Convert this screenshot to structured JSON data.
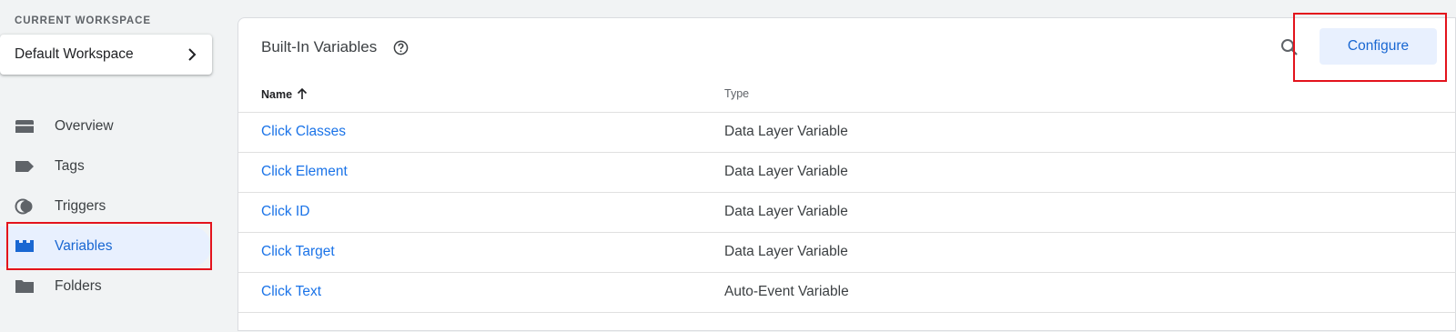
{
  "sidebar": {
    "workspace_label": "CURRENT WORKSPACE",
    "workspace_name": "Default Workspace",
    "items": [
      {
        "label": "Overview",
        "icon": "overview-icon"
      },
      {
        "label": "Tags",
        "icon": "tag-icon"
      },
      {
        "label": "Triggers",
        "icon": "trigger-icon"
      },
      {
        "label": "Variables",
        "icon": "variables-icon",
        "active": true
      },
      {
        "label": "Folders",
        "icon": "folder-icon"
      }
    ]
  },
  "main": {
    "title": "Built-In Variables",
    "configure_label": "Configure",
    "columns": {
      "name": "Name",
      "type": "Type"
    },
    "rows": [
      {
        "name": "Click Classes",
        "type": "Data Layer Variable"
      },
      {
        "name": "Click Element",
        "type": "Data Layer Variable"
      },
      {
        "name": "Click ID",
        "type": "Data Layer Variable"
      },
      {
        "name": "Click Target",
        "type": "Data Layer Variable"
      },
      {
        "name": "Click Text",
        "type": "Auto-Event Variable"
      }
    ]
  },
  "colors": {
    "accent": "#1a73e8",
    "active_bg": "#e8f0fe",
    "highlight": "#e3131c"
  }
}
